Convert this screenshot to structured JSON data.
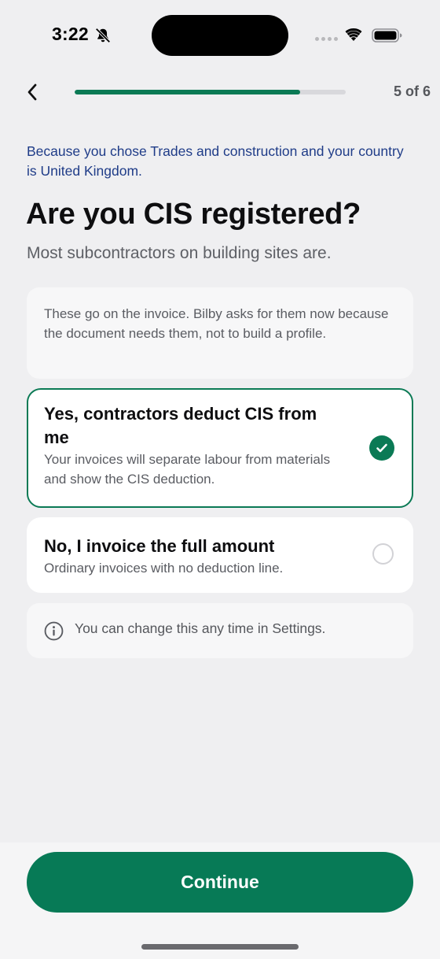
{
  "status_bar": {
    "time": "3:22",
    "icons": [
      "bell-slash-icon",
      "cellular-signal-icon",
      "wifi-icon",
      "battery-icon"
    ]
  },
  "nav": {
    "back_icon": "chevron-left-icon",
    "progress": 0.833,
    "step_label": "5 of 6"
  },
  "content": {
    "reason": "Because you chose Trades and construction and your country is United Kingdom.",
    "title": "Are you CIS registered?",
    "subtitle": "Most subcontractors on building sites are.",
    "note": "These go on the invoice. Bilby asks for them now because the document needs them, not to build a profile.",
    "options": [
      {
        "title": "Yes, contractors deduct CIS from me",
        "description": "Your invoices will separate labour from materials and show the CIS deduction.",
        "selected": true
      },
      {
        "title": "No, I invoice the full amount",
        "description": "Ordinary invoices with no deduction line.",
        "selected": false
      }
    ],
    "info_text": "You can change this any time in Settings."
  },
  "footer": {
    "continue_label": "Continue"
  },
  "colors": {
    "accent": "#0b7a55",
    "reason_text": "#1f3c88",
    "background": "#efeff1"
  }
}
